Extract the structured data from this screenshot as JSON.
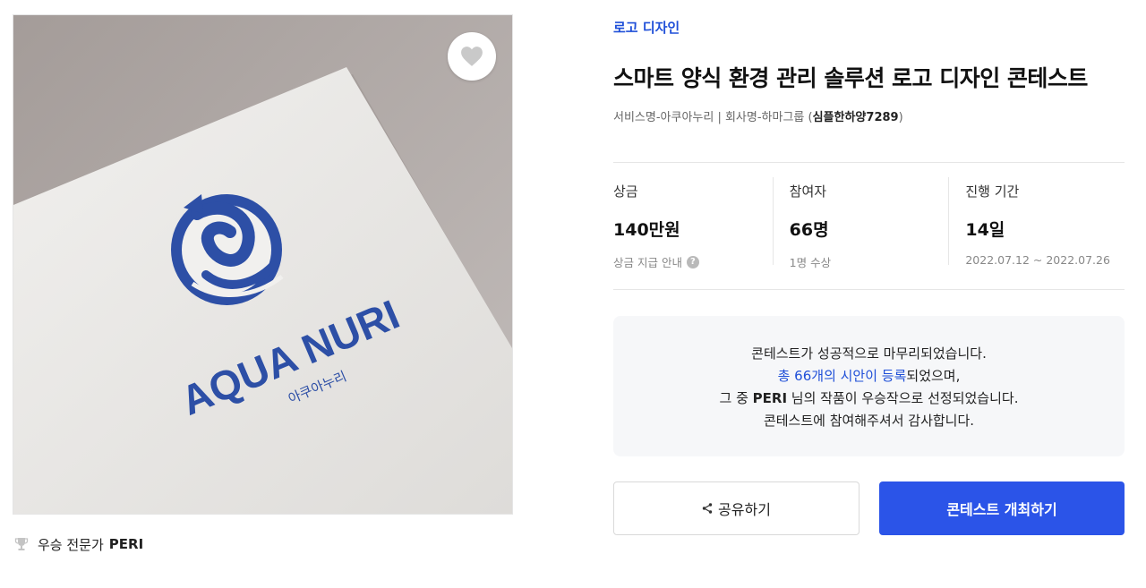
{
  "hero": {
    "brand_text": "AQUA NURI",
    "brand_sub": "아쿠아누리"
  },
  "winner": {
    "label": "우승 전문가",
    "name": "PERI"
  },
  "contest": {
    "category": "로고 디자인",
    "title": "스마트 양식 환경 관리 솔루션 로고 디자인 콘테스트",
    "meta_prefix": "서비스명-아쿠아누리 | 회사명-하마그룹 (",
    "author": "심플한하양7289",
    "meta_suffix": ")"
  },
  "stats": [
    {
      "label": "상금",
      "value": "140만원",
      "sub": "상금 지급 안내"
    },
    {
      "label": "참여자",
      "value": "66명",
      "sub": "1명 수상"
    },
    {
      "label": "진행 기간",
      "value": "14일",
      "sub": "2022.07.12 ~ 2022.07.26"
    }
  ],
  "notice": {
    "line1": "콘테스트가 성공적으로 마무리되었습니다.",
    "line2_link": "총 66개의 시안이 등록",
    "line2_rest": "되었으며,",
    "line3_prefix": "그 중 ",
    "line3_name": "PERI",
    "line3_suffix": " 님의 작품이 우승작으로 선정되었습니다.",
    "line4": "콘테스트에 참여해주셔서 감사합니다."
  },
  "buttons": {
    "share": "공유하기",
    "host": "콘테스트 개최하기"
  },
  "colors": {
    "accent": "#2b54e8",
    "link": "#1f4fd8",
    "logo_blue": "#2d4fa6"
  }
}
